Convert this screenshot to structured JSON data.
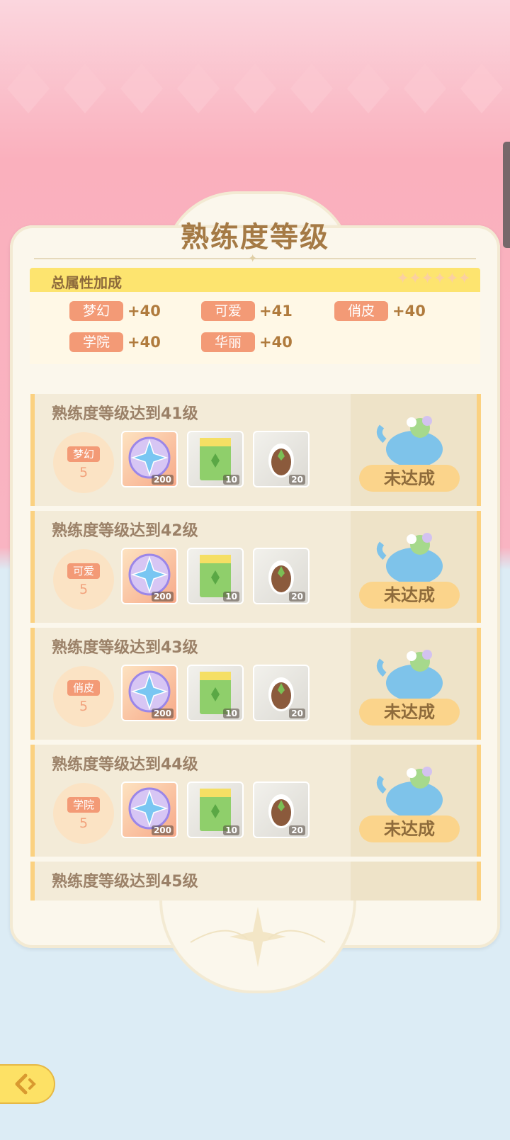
{
  "panel": {
    "title": "熟练度等级"
  },
  "attributes": {
    "header_label": "总属性加成",
    "items": [
      {
        "tag": "梦幻",
        "value": "+40"
      },
      {
        "tag": "可爱",
        "value": "+41"
      },
      {
        "tag": "俏皮",
        "value": "+40"
      },
      {
        "tag": "学院",
        "value": "+40"
      },
      {
        "tag": "华丽",
        "value": "+40"
      }
    ]
  },
  "rewards": [
    {
      "title": "熟练度等级达到41级",
      "badge_tag": "梦幻",
      "badge_num": "5",
      "item1_count": "200",
      "item2_count": "10",
      "item3_count": "20",
      "status": "未达成"
    },
    {
      "title": "熟练度等级达到42级",
      "badge_tag": "可爱",
      "badge_num": "5",
      "item1_count": "200",
      "item2_count": "10",
      "item3_count": "20",
      "status": "未达成"
    },
    {
      "title": "熟练度等级达到43级",
      "badge_tag": "俏皮",
      "badge_num": "5",
      "item1_count": "200",
      "item2_count": "10",
      "item3_count": "20",
      "status": "未达成"
    },
    {
      "title": "熟练度等级达到44级",
      "badge_tag": "学院",
      "badge_num": "5",
      "item1_count": "200",
      "item2_count": "10",
      "item3_count": "20",
      "status": "未达成"
    },
    {
      "title": "熟练度等级达到45级"
    }
  ],
  "icons": {
    "item1": "compass-star-icon",
    "item2": "seed-bag-icon",
    "item3": "seed-icon",
    "reward_art": "elephant-watering-can-icon",
    "back": "back-arrow-icon"
  },
  "colors": {
    "tag": "#f39a76",
    "title": "#a57a45",
    "status_button": "#fbd48b",
    "header_bar": "#fde46f"
  }
}
